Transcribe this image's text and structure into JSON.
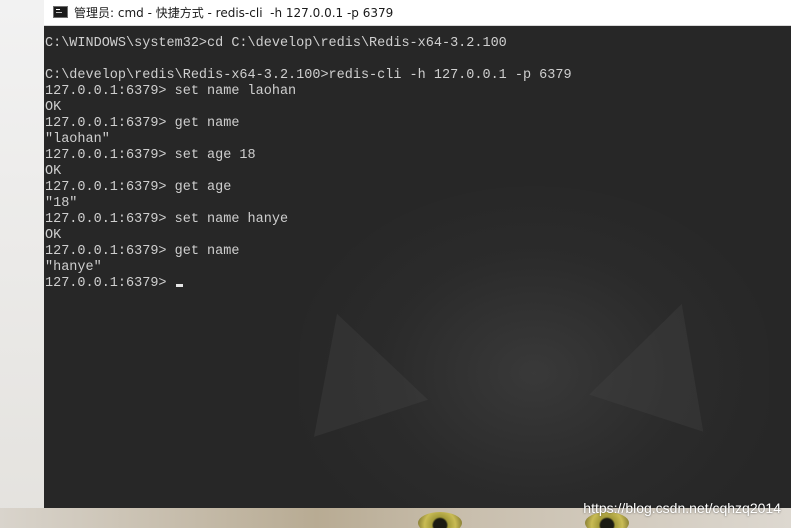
{
  "window": {
    "title": "管理员: cmd - 快捷方式 - redis-cli  -h 127.0.0.1 -p 6379",
    "icon": "cmd-console-icon"
  },
  "console": {
    "background": "#272727",
    "foreground": "#cfcfcf",
    "lines": [
      "C:\\WINDOWS\\system32>cd C:\\develop\\redis\\Redis-x64-3.2.100",
      "",
      "C:\\develop\\redis\\Redis-x64-3.2.100>redis-cli -h 127.0.0.1 -p 6379",
      "127.0.0.1:6379> set name laohan",
      "OK",
      "127.0.0.1:6379> get name",
      "\"laohan\"",
      "127.0.0.1:6379> set age 18",
      "OK",
      "127.0.0.1:6379> get age",
      "\"18\"",
      "127.0.0.1:6379> set name hanye",
      "OK",
      "127.0.0.1:6379> get name",
      "\"hanye\"",
      "127.0.0.1:6379> "
    ]
  },
  "watermark": "https://blog.csdn.net/cqhzq2014"
}
